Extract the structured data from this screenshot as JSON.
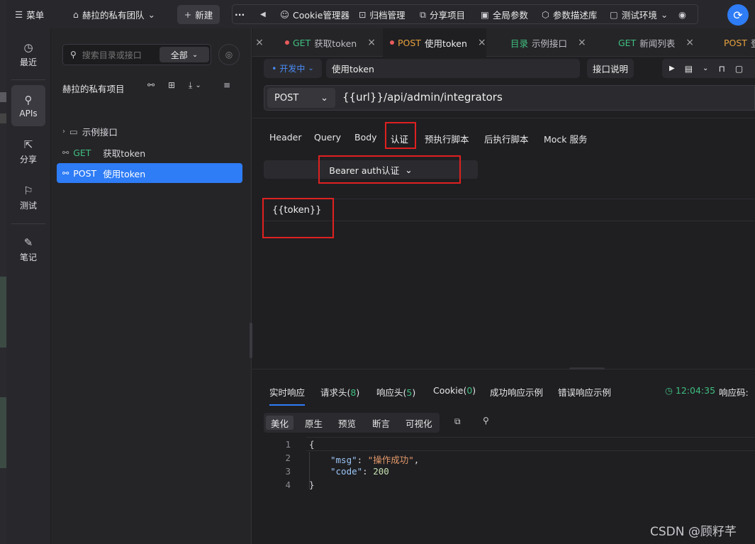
{
  "topbar": {
    "menu_label": "菜单",
    "team_label": "赫拉的私有团队",
    "new_label": "新建",
    "more_label": "···",
    "tools": [
      "Cookie管理器",
      "归档管理",
      "分享项目",
      "全局参数",
      "参数描述库"
    ],
    "env_label": "测试环境"
  },
  "nav": [
    {
      "label": "最近",
      "icon": "clock-icon"
    },
    {
      "label": "APIs",
      "icon": "link-icon",
      "active": true
    },
    {
      "label": "分享",
      "icon": "share-icon"
    },
    {
      "label": "测试",
      "icon": "test-icon"
    },
    {
      "label": "笔记",
      "icon": "note-icon"
    }
  ],
  "sidebar": {
    "search_placeholder": "搜索目录或接口",
    "scope": "全部",
    "project_title": "赫拉的私有项目",
    "tree": [
      {
        "type": "folder",
        "label": "示例接口"
      },
      {
        "type": "api",
        "method": "GET",
        "label": "获取token"
      },
      {
        "type": "api",
        "method": "POST",
        "label": "使用token",
        "selected": true
      }
    ]
  },
  "tabs": [
    {
      "method": "GET",
      "label": "获取token"
    },
    {
      "method": "POST",
      "label": "使用token",
      "active": true,
      "modified": true
    },
    {
      "method": "目录",
      "label": "示例接口"
    },
    {
      "method": "GET",
      "label": "新闻列表"
    },
    {
      "method": "POST",
      "label": "登"
    }
  ],
  "request": {
    "status": "开发中",
    "name": "使用token",
    "doc_button": "接口说明",
    "method": "POST",
    "url": "{{url}}/api/admin/integrators",
    "subtabs": [
      "Header",
      "Query",
      "Body",
      "认证",
      "预执行脚本",
      "后执行脚本",
      "Mock 服务"
    ],
    "auth_type": "Bearer auth认证",
    "token_value": "{{token}}"
  },
  "response": {
    "tabs": [
      {
        "label": "实时响应"
      },
      {
        "label": "请求头",
        "count": "8"
      },
      {
        "label": "响应头",
        "count": "5"
      },
      {
        "label": "Cookie",
        "count": "0"
      },
      {
        "label": "成功响应示例"
      },
      {
        "label": "错误响应示例"
      }
    ],
    "time": "12:04:35",
    "code_label": "响应码:",
    "formats": [
      "美化",
      "原生",
      "预览",
      "断言",
      "可视化"
    ],
    "body_lines": [
      {
        "n": "1",
        "text": "{"
      },
      {
        "n": "2",
        "key": "\"msg\"",
        "value": "\"操作成功\"",
        "trail": ","
      },
      {
        "n": "3",
        "key": "\"code\"",
        "value": "200",
        "trail": ""
      },
      {
        "n": "4",
        "text": "}"
      }
    ]
  },
  "watermark": "CSDN @顾籽芊",
  "colors": {
    "accent": "#2e7cf6",
    "get": "#3fbf7f",
    "post": "#e8a23c",
    "highlight": "#e02020"
  }
}
